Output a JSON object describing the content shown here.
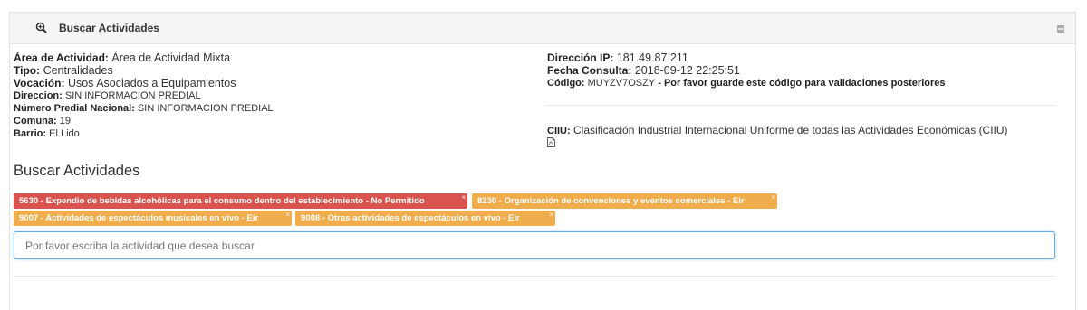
{
  "panel": {
    "title": "Buscar Actividades"
  },
  "info_left": [
    {
      "label": "Área de Actividad:",
      "value": " Área de Actividad Mixta",
      "big": true
    },
    {
      "label": "Tipo:",
      "value": " Centralidades",
      "big": true
    },
    {
      "label": "Vocación:",
      "value": " Usos Asociados a Equipamientos",
      "big": true
    },
    {
      "label": "Direccion:",
      "value": " SIN INFORMACION PREDIAL",
      "big": false
    },
    {
      "label": "Número Predial Nacional:",
      "value": " SIN INFORMACION PREDIAL",
      "big": false
    },
    {
      "label": "Comuna:",
      "value": " 19",
      "big": false
    },
    {
      "label": "Barrio:",
      "value": " El Lido",
      "big": false
    }
  ],
  "info_right": {
    "ip_label": "Dirección IP:",
    "ip_value": " 181.49.87.211",
    "fecha_label": "Fecha Consulta:",
    "fecha_value": " 2018-09-12 22:25:51",
    "codigo_label": "Código:",
    "codigo_value": " MUYZV7OSZY",
    "codigo_note": " - Por favor guarde este código para validaciones posteriores",
    "ciiu_label": "CIIU:",
    "ciiu_value": " Clasificación Industrial Internacional Uniforme de todas las Actividades Económicas (CIIU)"
  },
  "section_title": "Buscar Actividades",
  "tags": [
    {
      "text": "5630 - Expendio de bebidas alcohólicas para el consumo dentro del establecimiento - No Permitido",
      "status": "no-permitido",
      "color": "#d9534f"
    },
    {
      "text": "8230 - Organización de convenciones y eventos comerciales - Eir",
      "status": "eir",
      "color": "#f0ad4e"
    },
    {
      "text": "9007 - Actividades de espectáculos musicales en vivo - Eir",
      "status": "eir",
      "color": "#f0ad4e"
    },
    {
      "text": "9008 - Otras actividades de espectáculos en vivo - Eir",
      "status": "eir",
      "color": "#f0ad4e"
    }
  ],
  "tag_remove_glyph": "×",
  "search": {
    "placeholder": "Por favor escriba la actividad que desea buscar",
    "value": ""
  },
  "icons": {
    "header": "search-plus-icon",
    "collapse": "collapse-icon",
    "ciiu_doc": "pdf-file-icon"
  },
  "colors": {
    "danger": "#d9534f",
    "warning": "#f0ad4e",
    "focus_border": "#66afe9"
  }
}
